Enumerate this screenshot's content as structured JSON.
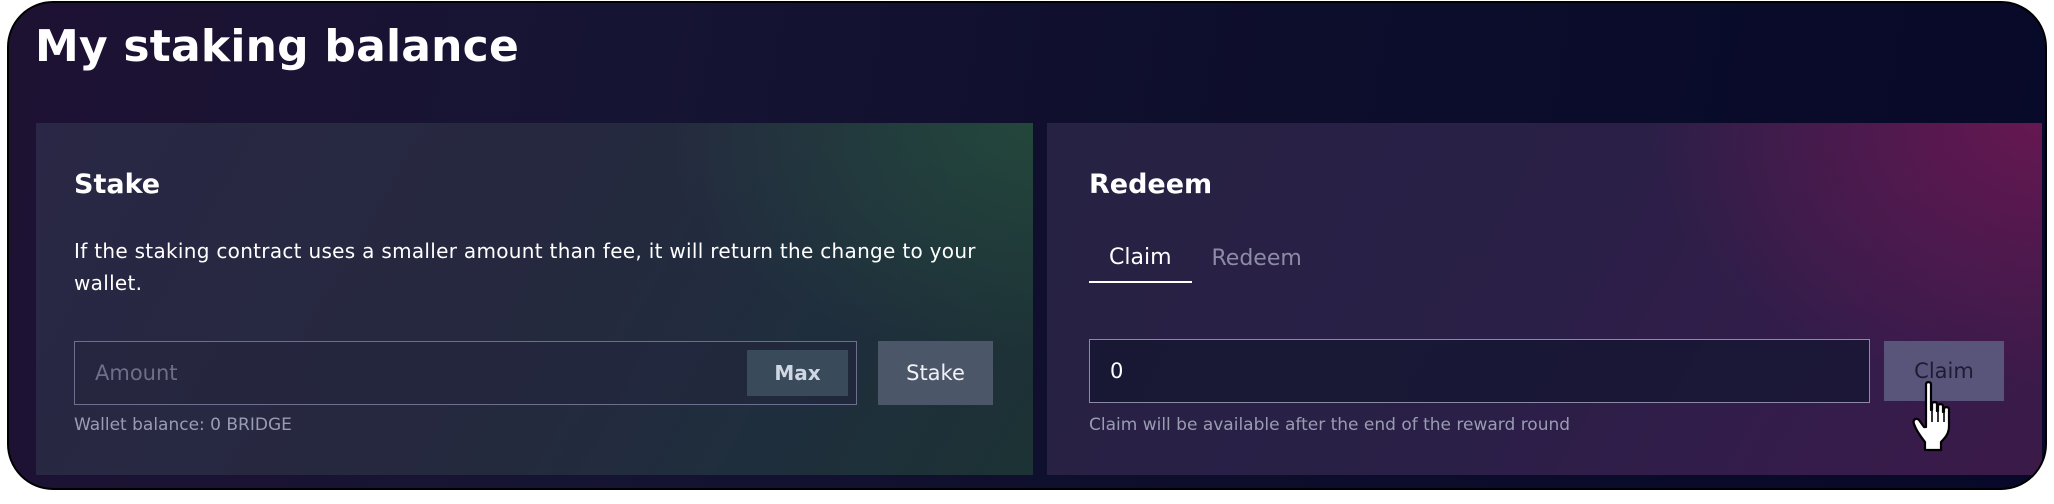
{
  "page": {
    "title": "My staking balance"
  },
  "stake": {
    "title": "Stake",
    "description": "If the staking contract uses a smaller amount than fee, it will return the change to your wallet.",
    "amount_placeholder": "Amount",
    "amount_value": "",
    "max_label": "Max",
    "stake_label": "Stake",
    "wallet_balance": "Wallet balance: 0 BRIDGE"
  },
  "redeem": {
    "title": "Redeem",
    "tabs": [
      {
        "label": "Claim",
        "active": true
      },
      {
        "label": "Redeem",
        "active": false
      }
    ],
    "claim_value": "0",
    "claim_button_label": "Claim",
    "claim_note": "Claim will be available after the end of the reward round"
  },
  "cursor": {
    "icon": "hand-pointer-icon"
  },
  "colors": {
    "background": "#0d0e2c",
    "stake_panel": "#26283f",
    "redeem_panel": "#2a1f47",
    "text_primary": "#ffffff",
    "text_muted": "#9a9cb2",
    "max_button": "#394a5a",
    "stake_button": "#4b5669",
    "claim_button": "#59547a"
  }
}
